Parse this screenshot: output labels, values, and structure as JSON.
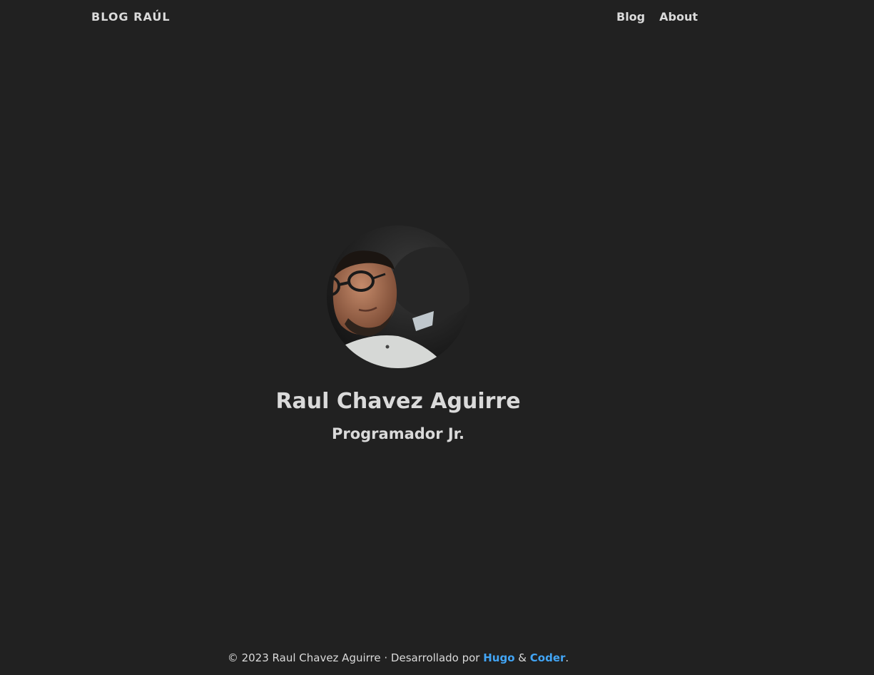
{
  "navbar": {
    "brand": "BLOG RAÚL",
    "links": [
      {
        "label": "Blog"
      },
      {
        "label": "About"
      }
    ]
  },
  "profile": {
    "name": "Raul Chavez Aguirre",
    "role": "Programador Jr."
  },
  "footer": {
    "copyright": "© 2023 Raul Chavez Aguirre · Desarrollado por ",
    "link1": "Hugo",
    "separator": " & ",
    "link2": "Coder",
    "end": "."
  },
  "colors": {
    "background": "#212121",
    "text": "#dadada",
    "accent": "#42a5f5"
  }
}
